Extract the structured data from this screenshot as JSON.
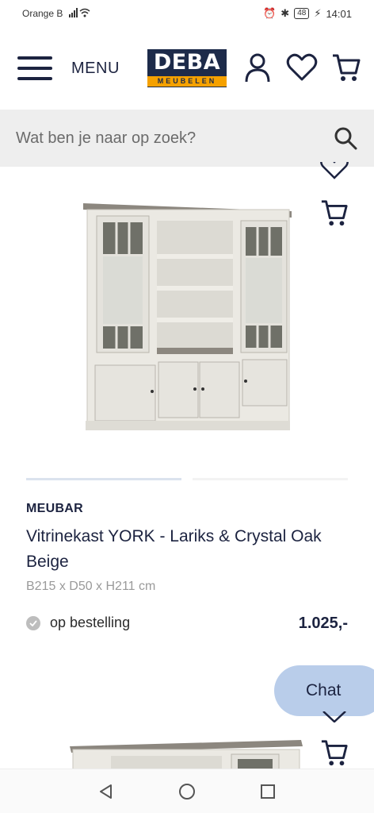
{
  "status_bar": {
    "carrier": "Orange B",
    "battery": "48",
    "time": "14:01"
  },
  "header": {
    "menu_label": "MENU",
    "logo_main": "DEBA",
    "logo_sub": "MEUBELEN",
    "icons": [
      "account-icon",
      "heart-icon",
      "cart-icon"
    ]
  },
  "search": {
    "placeholder": "Wat ben je naar op zoek?"
  },
  "product": {
    "brand": "MEUBAR",
    "title": "Vitrinekast YORK - Lariks & Crystal Oak Beige",
    "dimensions": "B215 x D50 x H211 cm",
    "availability": "op bestelling",
    "price": "1.025,-",
    "image_progress": {
      "current": 1,
      "total": 2
    }
  },
  "chat": {
    "label": "Chat"
  },
  "colors": {
    "navy": "#1c2340",
    "logo_bg": "#1d2b4a",
    "logo_accent": "#f5a100",
    "chat_bg": "#b9cdea",
    "search_bg": "#eeeeee"
  }
}
